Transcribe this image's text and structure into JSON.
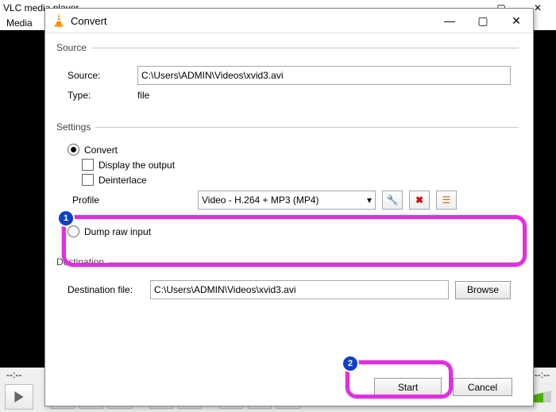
{
  "vlc": {
    "title": "VLC media player",
    "menu_media": "Media",
    "time_left": "--:--",
    "time_right": "--:--"
  },
  "dialog": {
    "title": "Convert",
    "source_section": "Source",
    "source_label": "Source:",
    "source_value": "C:\\Users\\ADMIN\\Videos\\xvid3.avi",
    "type_label": "Type:",
    "type_value": "file",
    "settings_section": "Settings",
    "convert_radio": "Convert",
    "display_output": "Display the output",
    "deinterlace": "Deinterlace",
    "profile_label": "Profile",
    "profile_value": "Video - H.264 + MP3 (MP4)",
    "dump_raw": "Dump raw input",
    "destination_section": "Destination",
    "dest_label": "Destination file:",
    "dest_value": "C:\\Users\\ADMIN\\Videos\\xvid3.avi",
    "browse": "Browse",
    "start": "Start",
    "cancel": "Cancel",
    "callouts": {
      "one": "1",
      "two": "2"
    }
  },
  "icons": {
    "wrench": "🔧",
    "delete": "✖",
    "new": "☰"
  }
}
